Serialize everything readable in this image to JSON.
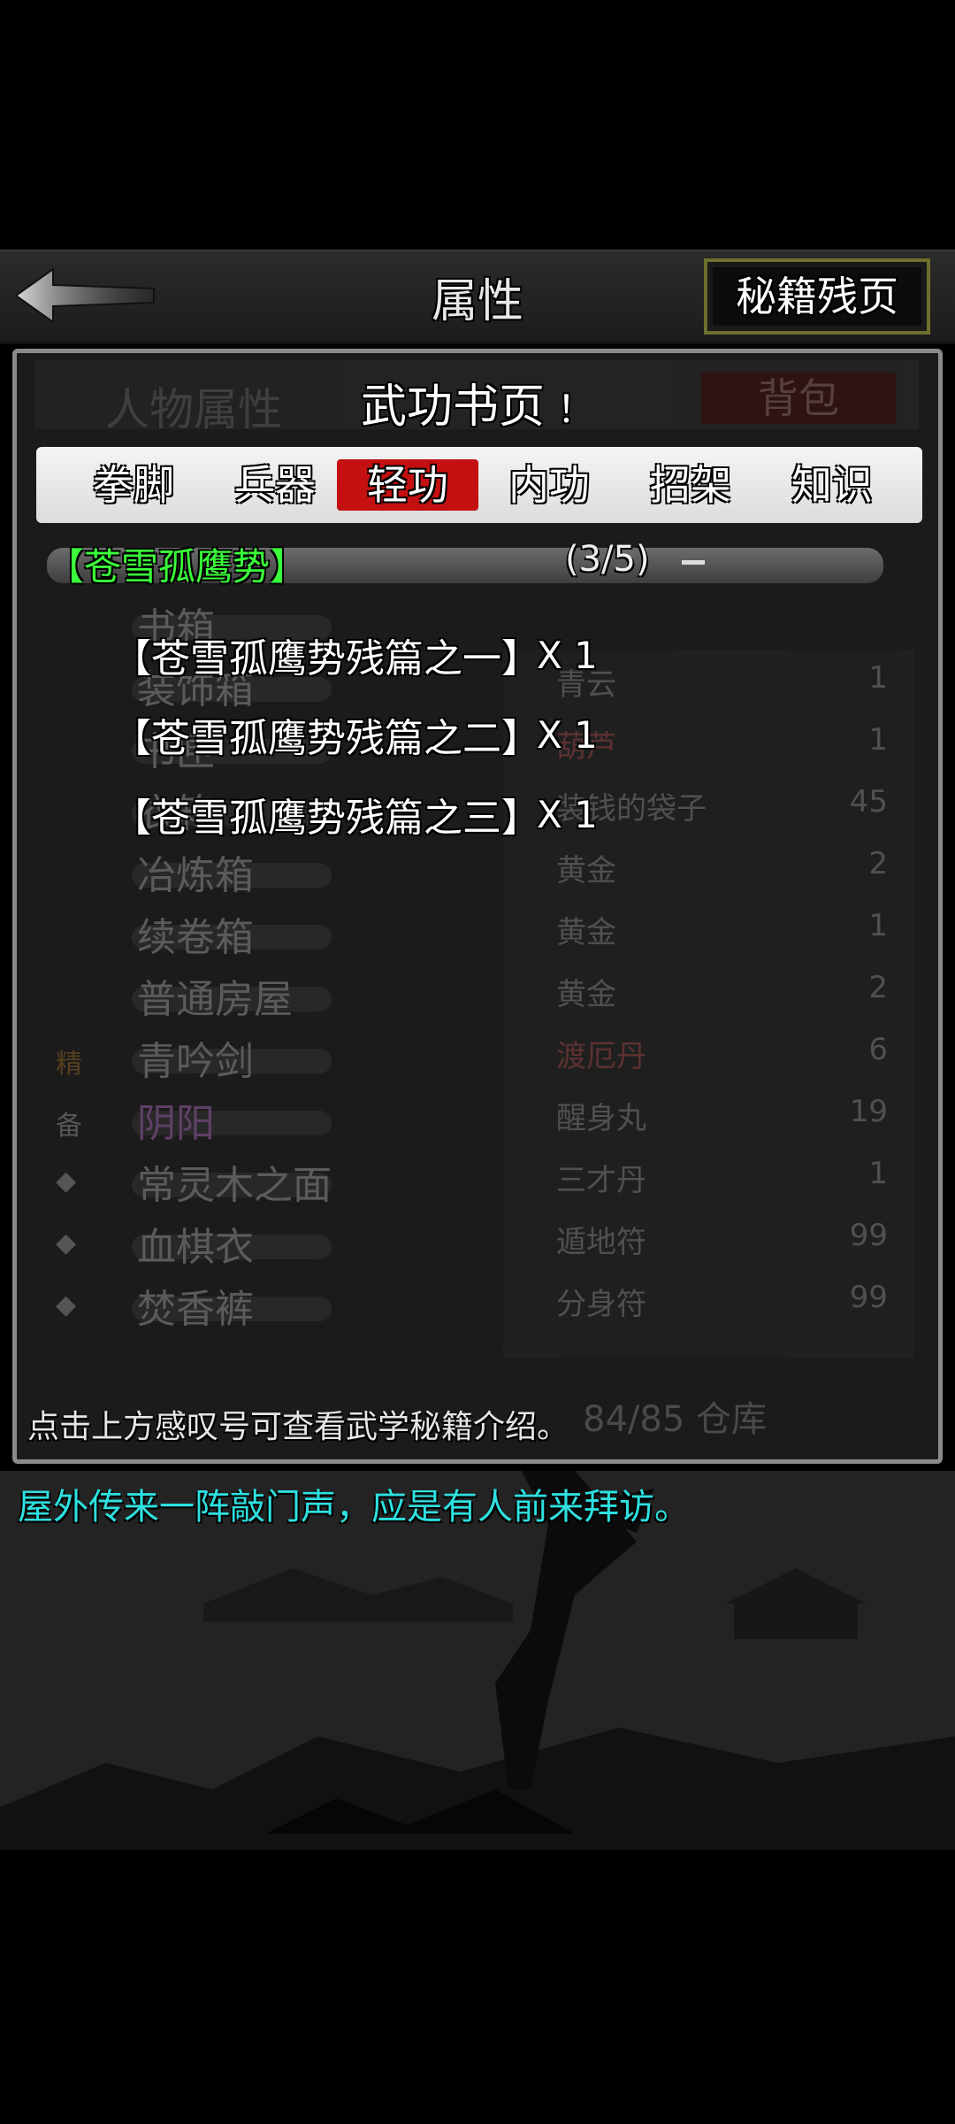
{
  "header": {
    "title": "属性",
    "right_button": "秘籍残页",
    "back_icon": "back-arrow-icon"
  },
  "background_screen": {
    "left_tab": "人物属性",
    "right_tab": "背包",
    "list": [
      {
        "mark": "",
        "name": "书箱",
        "color": ""
      },
      {
        "mark": "",
        "name": "装饰箱",
        "color": ""
      },
      {
        "mark": "",
        "name": "书匣",
        "color": ""
      },
      {
        "mark": "",
        "name": "衣箱",
        "color": ""
      },
      {
        "mark": "",
        "name": "冶炼箱",
        "color": ""
      },
      {
        "mark": "",
        "name": "续卷箱",
        "color": ""
      },
      {
        "mark": "",
        "name": "普通房屋",
        "color": ""
      },
      {
        "mark": "精",
        "name": "青吟剑",
        "color": "gold"
      },
      {
        "mark": "备",
        "name": "阴阳",
        "color": "purple"
      },
      {
        "mark": "◆",
        "name": "常灵木之面",
        "color": ""
      },
      {
        "mark": "◆",
        "name": "血棋衣",
        "color": ""
      },
      {
        "mark": "◆",
        "name": "焚香裤",
        "color": ""
      }
    ],
    "items": [
      {
        "name": "青云",
        "qty": "1",
        "color": ""
      },
      {
        "name": "葫芦",
        "qty": "1",
        "color": "red"
      },
      {
        "name": "装钱的袋子",
        "qty": "45",
        "color": ""
      },
      {
        "name": "黄金",
        "qty": "2",
        "color": ""
      },
      {
        "name": "黄金",
        "qty": "1",
        "color": ""
      },
      {
        "name": "黄金",
        "qty": "2",
        "color": ""
      },
      {
        "name": "渡厄丹",
        "qty": "6",
        "color": "red"
      },
      {
        "name": "醒身丸",
        "qty": "19",
        "color": ""
      },
      {
        "name": "三才丹",
        "qty": "1",
        "color": ""
      },
      {
        "name": "遁地符",
        "qty": "99",
        "color": ""
      },
      {
        "name": "分身符",
        "qty": "99",
        "color": ""
      }
    ],
    "capacity": "84/85 仓库"
  },
  "dialog": {
    "title": "武功书页",
    "info_mark": "！",
    "tabs": [
      {
        "label": "拳脚",
        "active": false
      },
      {
        "label": "兵器",
        "active": false
      },
      {
        "label": "轻功",
        "active": true
      },
      {
        "label": "内功",
        "active": false
      },
      {
        "label": "招架",
        "active": false
      },
      {
        "label": "知识",
        "active": false
      }
    ],
    "group": {
      "name": "【苍雪孤鹰势】",
      "progress": "(3/5)"
    },
    "pages": [
      {
        "name": "【苍雪孤鹰势残篇之一】",
        "qty": "X 1"
      },
      {
        "name": "【苍雪孤鹰势残篇之二】",
        "qty": "X 1"
      },
      {
        "name": "【苍雪孤鹰势残篇之三】",
        "qty": "X 1"
      }
    ],
    "hint": "点击上方感叹号可查看武学秘籍介绍。"
  },
  "log": {
    "message": "屋外传来一阵敲门声，应是有人前来拜访。"
  },
  "colors": {
    "active_tab": "#c41010",
    "group_name": "#3aff3a",
    "log_text": "#2fe0e0",
    "panel_border": "#8a8a8a"
  }
}
